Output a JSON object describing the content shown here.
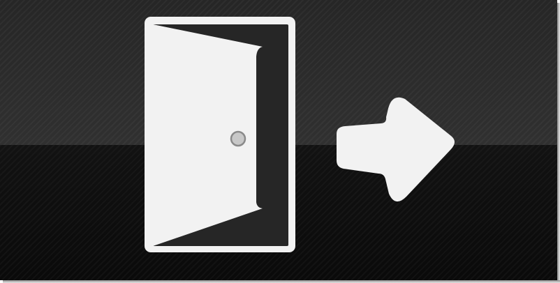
{
  "image": {
    "subject": "exit-door-sign",
    "icons": [
      "open-door-icon",
      "right-arrow-icon"
    ],
    "colors": {
      "background_top": "#2b2b2b",
      "background_bottom": "#0e0e0e",
      "symbol": "#f2f2f2",
      "door_gap": "#262626",
      "door_knob": "#c8c8c8"
    }
  }
}
